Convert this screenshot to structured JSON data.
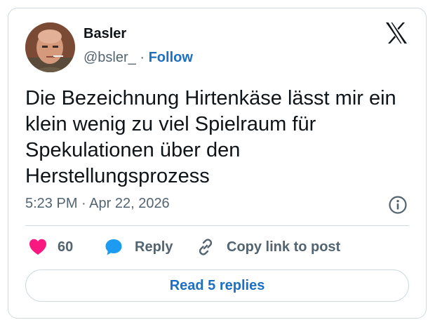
{
  "author": {
    "name": "Basler",
    "handle": "@bsler_",
    "separator": "·",
    "follow_label": "Follow"
  },
  "tweet": {
    "lines": [
      "Die Bezeichnung Hirtenkäse lässt mir ein",
      "klein wenig zu viel Spielraum für",
      "Spekulationen über den",
      "Herstellungsprozess"
    ],
    "timestamp": "5:23 PM · Apr 22, 2026"
  },
  "actions": {
    "like_count": "60",
    "reply_label": "Reply",
    "copy_label": "Copy link to post"
  },
  "footer": {
    "read_replies_label": "Read 5 replies"
  },
  "icons": {
    "brand": "x-logo-icon",
    "info": "info-icon",
    "like": "heart-icon",
    "reply": "speech-bubble-icon",
    "copy": "link-icon"
  },
  "colors": {
    "heart": "#f91880",
    "reply_bubble": "#1d9bf0",
    "link_blue": "#1d6fc2",
    "muted_text": "#536471",
    "border": "#cfd9de"
  }
}
